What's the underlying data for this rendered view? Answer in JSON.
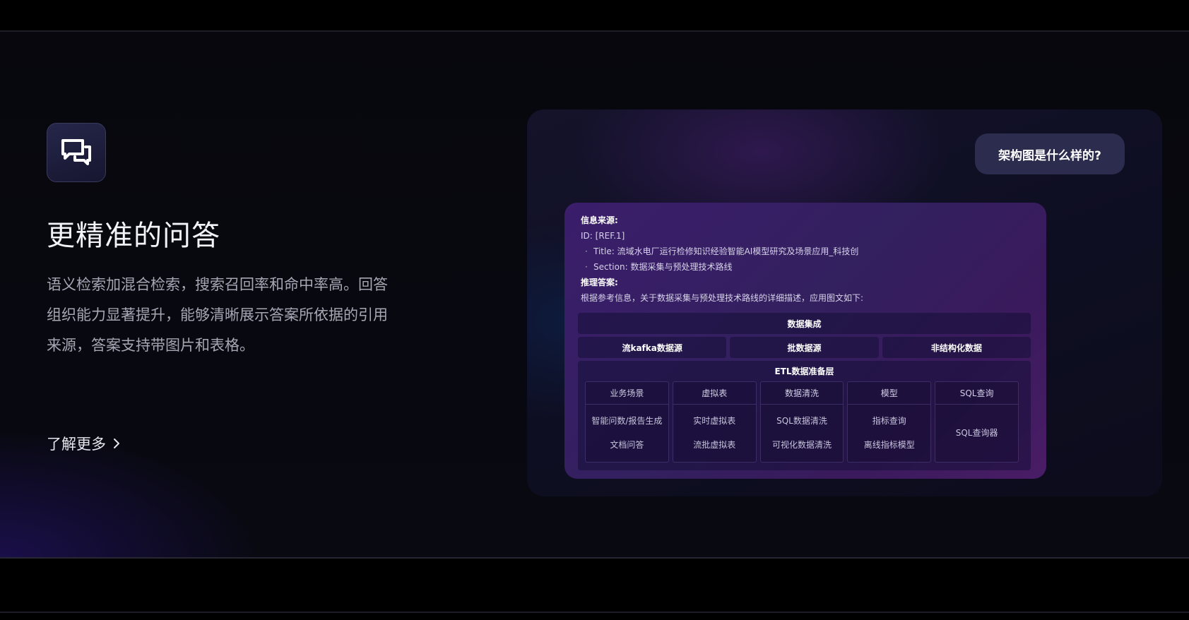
{
  "feature": {
    "icon": "chat-bubbles-icon",
    "title": "更精准的问答",
    "description": "语义检索加混合检索，搜索召回率和命中率高。回答组织能力显著提升，能够清晰展示答案所依据的引用来源，答案支持带图片和表格。",
    "learn_more": "了解更多"
  },
  "demo": {
    "question": "架构图是什么样的?",
    "answer": {
      "source_label": "信息来源:",
      "id_line": "ID: [REF.1]",
      "title_line": "Title: 流域水电厂运行检修知识经验智能AI模型研究及场景应用_科技创",
      "section_line": "Section: 数据采集与预处理技术路线",
      "reasoning_label": "推理答案:",
      "intro": "根据参考信息，关于数据采集与预处理技术路线的详细描述，应用图文如下:"
    },
    "diagram": {
      "top": "数据集成",
      "sources": [
        "流kafka数据源",
        "批数据源",
        "非结构化数据"
      ],
      "etl_title": "ETL数据准备层",
      "columns": [
        {
          "header": "业务场景",
          "items": [
            "智能问数/报告生成",
            "文档问答"
          ]
        },
        {
          "header": "虚拟表",
          "items": [
            "实时虚拟表",
            "流批虚拟表"
          ]
        },
        {
          "header": "数据清洗",
          "items": [
            "SQL数据清洗",
            "可视化数据清洗"
          ]
        },
        {
          "header": "模型",
          "items": [
            "指标查询",
            "离线指标模型"
          ]
        },
        {
          "header": "SQL查询",
          "items": [
            "SQL查询器"
          ]
        }
      ]
    }
  },
  "colors": {
    "background": "#07070d",
    "card_purple": "#3b1d6b",
    "bubble": "#2c2c4e"
  }
}
